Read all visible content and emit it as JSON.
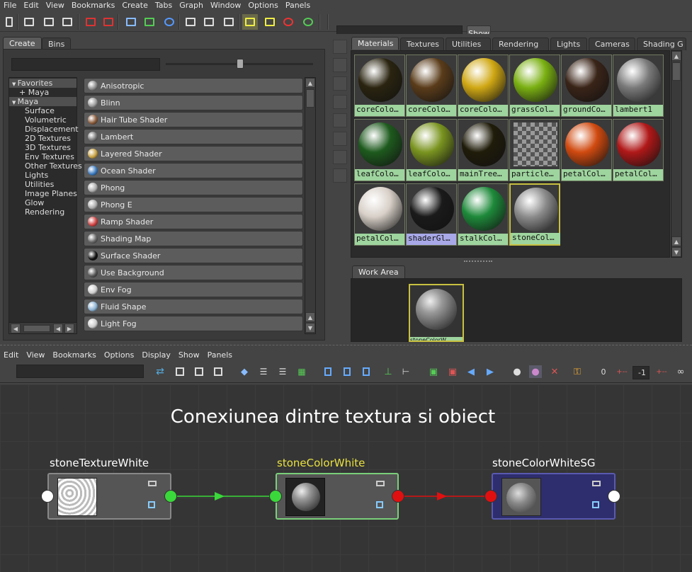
{
  "menubar": [
    "File",
    "Edit",
    "View",
    "Bookmarks",
    "Create",
    "Tabs",
    "Graph",
    "Window",
    "Options",
    "Panels"
  ],
  "show_button": "Show",
  "left_tabs": [
    "Create",
    "Bins"
  ],
  "tree": [
    {
      "label": "Favorites",
      "hl": true,
      "indent": 8
    },
    {
      "label": "+ Maya",
      "hl": false,
      "indent": 14
    },
    {
      "label": "Maya",
      "hl": true,
      "indent": 8
    },
    {
      "label": "Surface",
      "hl": false,
      "indent": 22
    },
    {
      "label": "Volumetric",
      "hl": false,
      "indent": 22
    },
    {
      "label": "Displacement",
      "hl": false,
      "indent": 22
    },
    {
      "label": "2D Textures",
      "hl": false,
      "indent": 22
    },
    {
      "label": "3D Textures",
      "hl": false,
      "indent": 22
    },
    {
      "label": "Env Textures",
      "hl": false,
      "indent": 22
    },
    {
      "label": "Other Textures",
      "hl": false,
      "indent": 22
    },
    {
      "label": "Lights",
      "hl": false,
      "indent": 22
    },
    {
      "label": "Utilities",
      "hl": false,
      "indent": 22
    },
    {
      "label": "Image Planes",
      "hl": false,
      "indent": 22
    },
    {
      "label": "Glow",
      "hl": false,
      "indent": 22
    },
    {
      "label": "Rendering",
      "hl": false,
      "indent": 22
    }
  ],
  "nodes": [
    {
      "label": "Anisotropic",
      "color": "#888"
    },
    {
      "label": "Blinn",
      "color": "#999"
    },
    {
      "label": "Hair Tube Shader",
      "color": "#8a5a3a"
    },
    {
      "label": "Lambert",
      "color": "#777"
    },
    {
      "label": "Layered Shader",
      "color": "#c8a040"
    },
    {
      "label": "Ocean Shader",
      "color": "#3a7ac0"
    },
    {
      "label": "Phong",
      "color": "#aaa"
    },
    {
      "label": "Phong E",
      "color": "#aaa"
    },
    {
      "label": "Ramp Shader",
      "color": "#d04040"
    },
    {
      "label": "Shading Map",
      "color": "#666"
    },
    {
      "label": "Surface Shader",
      "color": "#111"
    },
    {
      "label": "Use Background",
      "color": "#555"
    },
    {
      "label": "Env Fog",
      "color": "#ccc"
    },
    {
      "label": "Fluid Shape",
      "color": "#8ab0d0"
    },
    {
      "label": "Light Fog",
      "color": "#ccc"
    }
  ],
  "right_tabs": [
    "Materials",
    "Textures",
    "Utilities",
    "Rendering",
    "Lights",
    "Cameras",
    "Shading G"
  ],
  "swatches": [
    {
      "label": "coreColo…",
      "color": "#2a2410",
      "lblbg": "#9ed49e"
    },
    {
      "label": "coreColo…",
      "color": "#5a3c1a",
      "lblbg": "#9ed49e"
    },
    {
      "label": "coreColo…",
      "color": "#d0a814",
      "lblbg": "#9ed49e"
    },
    {
      "label": "grassCol…",
      "color": "#7ab012",
      "lblbg": "#9ed49e"
    },
    {
      "label": "groundCo…",
      "color": "#3a2418",
      "lblbg": "#9ed49e"
    },
    {
      "label": "lambert1",
      "color": "#7a7a7a",
      "lblbg": "#9ed49e"
    },
    {
      "label": "leafColo…",
      "color": "#1e5a1e",
      "lblbg": "#9ed49e"
    },
    {
      "label": "leafColo…",
      "color": "#7a9420",
      "lblbg": "#9ed49e"
    },
    {
      "label": "mainTree…",
      "color": "#201c0a",
      "lblbg": "#9ed49e"
    },
    {
      "label": "particle…",
      "color": "#5a7a8a",
      "lblbg": "#9ed49e"
    },
    {
      "label": "petalCol…",
      "color": "#d04a10",
      "lblbg": "#9ed49e"
    },
    {
      "label": "petalCol…",
      "color": "#b01818",
      "lblbg": "#9ed49e"
    },
    {
      "label": "petalCol…",
      "color": "#d8d0c8",
      "lblbg": "#9ed49e"
    },
    {
      "label": "shaderGl…",
      "color": "#1a1a1a",
      "lblbg": "#a8a8e8"
    },
    {
      "label": "stalkCol…",
      "color": "#1e8a3a",
      "lblbg": "#9ed49e"
    },
    {
      "label": "stoneCol…",
      "color": "#8a8a8a",
      "lblbg": "#9ed49e"
    }
  ],
  "work_area_tab": "Work Area",
  "work_area_swatch_label": "stoneColorW…",
  "ne_menubar": [
    "Edit",
    "View",
    "Bookmarks",
    "Options",
    "Display",
    "Show",
    "Panels"
  ],
  "ne_field_value": "-1",
  "ne_zero": "0",
  "graph_title": "Conexiunea dintre textura si obiect",
  "graph_nodes": [
    {
      "label": "stoneTextureWhite",
      "label_color": "#ffffff"
    },
    {
      "label": "stoneColorWhite",
      "label_color": "#e8e040"
    },
    {
      "label": "stoneColorWhiteSG",
      "label_color": "#ffffff"
    }
  ],
  "colors": {
    "green_port": "#3ad83a",
    "red_port": "#e01010",
    "white_port": "#ffffff",
    "sg_node": "#2e2e6e",
    "sel_node_border": "#7ad07a",
    "label_green": "#9ed49e",
    "label_blue": "#a8a8e8"
  }
}
